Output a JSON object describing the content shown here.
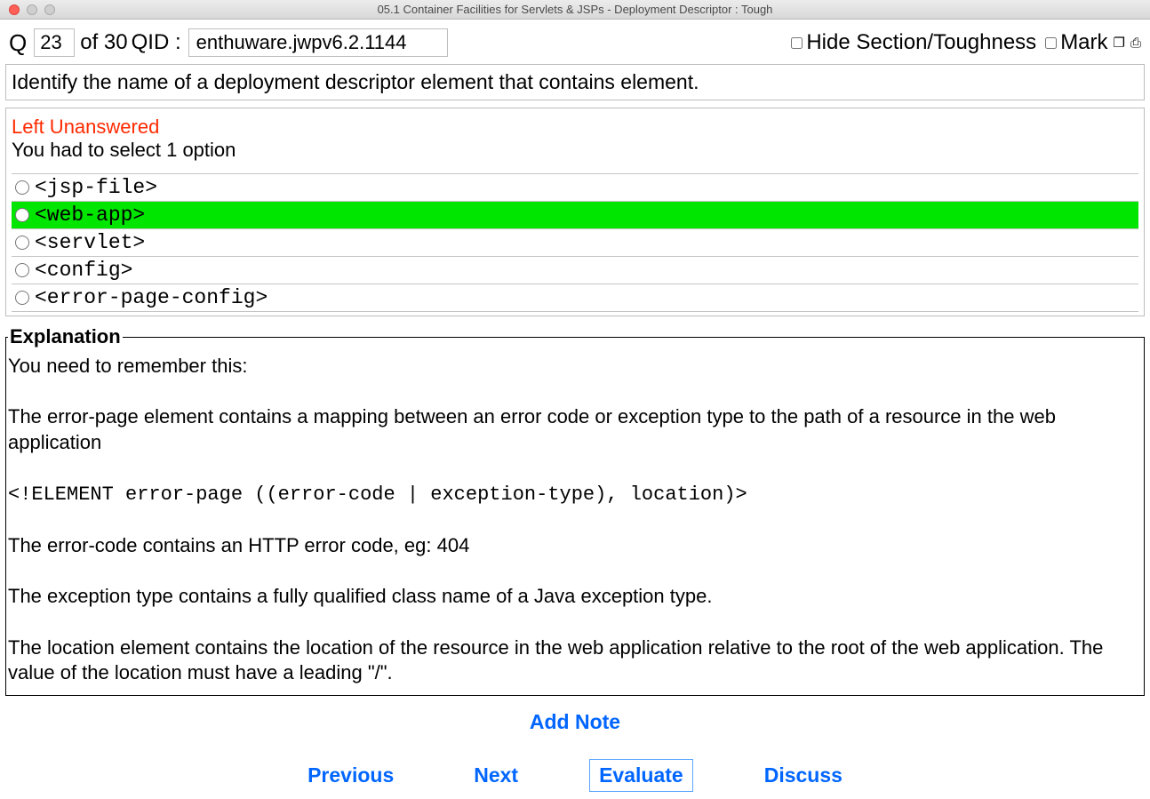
{
  "window": {
    "title": "05.1 Container Facilities for Servlets & JSPs - Deployment Descriptor  :  Tough"
  },
  "toolbar": {
    "q_label": "Q",
    "question_number": "23",
    "of_label": "of 30",
    "qid_label": "QID :",
    "qid_value": "enthuware.jwpv6.2.1144",
    "hide_section_label": "Hide Section/Toughness",
    "mark_label": "Mark",
    "window_icon": "❐",
    "print_icon": "⎙"
  },
  "question": {
    "text": "Identify the name of a deployment descriptor element that contains  element."
  },
  "answer": {
    "status": "Left Unanswered",
    "hint": "You had to select 1 option",
    "options": [
      {
        "text": "<jsp-file>",
        "correct": false
      },
      {
        "text": "<web-app>",
        "correct": true
      },
      {
        "text": "<servlet>",
        "correct": false
      },
      {
        "text": "<config>",
        "correct": false
      },
      {
        "text": "<error-page-config>",
        "correct": false
      }
    ]
  },
  "explanation": {
    "legend": "Explanation",
    "p1": "You need to remember this:",
    "p2": "The error-page element contains a mapping between an error code or exception type to the path of a resource in the web application",
    "code": "<!ELEMENT error-page ((error-code | exception-type), location)>",
    "p3": "The error-code contains an HTTP error code, eg: 404",
    "p4": "The exception type contains a fully qualified class name of a Java exception type.",
    "p5": "The location element contains the location of the resource in the web application relative to the root of the web application. The value of the location must have a leading \"/\"."
  },
  "footer": {
    "add_note": "Add Note",
    "previous": "Previous",
    "next": "Next",
    "evaluate": "Evaluate",
    "discuss": "Discuss"
  }
}
